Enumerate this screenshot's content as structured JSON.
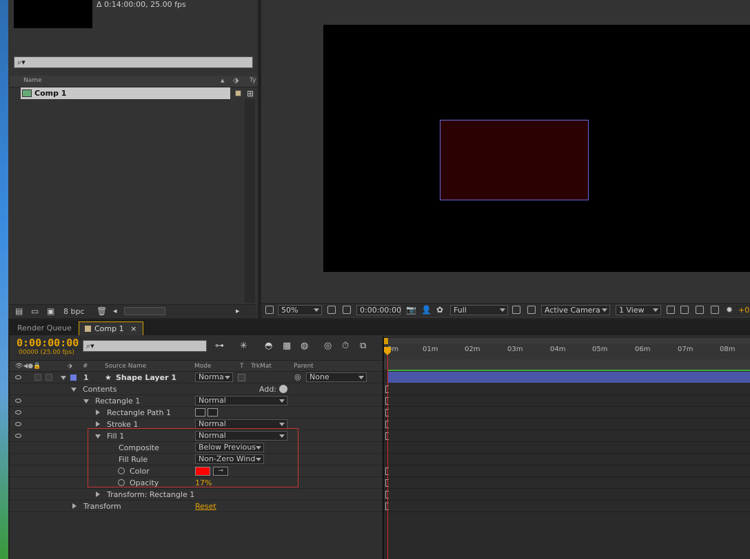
{
  "project": {
    "duration_info": "Δ 0:14:00:00, 25.00 fps",
    "search_placeholder": "",
    "columns": {
      "name": "Name",
      "type": "Ty"
    },
    "items": [
      {
        "name": "Comp 1"
      }
    ],
    "bpc": "8 bpc"
  },
  "viewer": {
    "zoom": "50%",
    "timecode": "0:00:00:00",
    "resolution": "Full",
    "camera": "Active Camera",
    "views": "1 View",
    "exposure": "+0"
  },
  "timeline": {
    "tabs": [
      {
        "label": "Render Queue"
      },
      {
        "label": "Comp 1"
      }
    ],
    "timecode": "0:00:00:00",
    "fps": "00000 (25.00 fps)",
    "columns": {
      "num": "#",
      "source": "Source Name",
      "mode": "Mode",
      "t": "T",
      "trkmat": "TrkMat",
      "parent": "Parent"
    },
    "ruler": [
      "0m",
      "01m",
      "02m",
      "03m",
      "04m",
      "05m",
      "06m",
      "07m",
      "08m"
    ],
    "layer": {
      "num": "1",
      "name": "Shape Layer 1",
      "mode": "Norma",
      "parent": "None",
      "label_color": "#6a7ce0"
    },
    "rows": {
      "contents": "Contents",
      "add": "Add:",
      "rectangle": "Rectangle 1",
      "rectangle_mode": "Normal",
      "rect_path": "Rectangle Path 1",
      "stroke": "Stroke 1",
      "stroke_mode": "Normal",
      "fill": "Fill 1",
      "fill_mode": "Normal",
      "composite": "Composite",
      "composite_val": "Below Previous",
      "fill_rule": "Fill Rule",
      "fill_rule_val": "Non-Zero Wind",
      "color": "Color",
      "color_val": "#ff0000",
      "opacity": "Opacity",
      "opacity_val": "17%",
      "transform_rect": "Transform: Rectangle 1",
      "transform": "Transform",
      "reset": "Reset"
    }
  },
  "colors": {
    "accent": "#e8a400",
    "layer_bar": "#4a56a8",
    "playhead": "#dd2222"
  }
}
